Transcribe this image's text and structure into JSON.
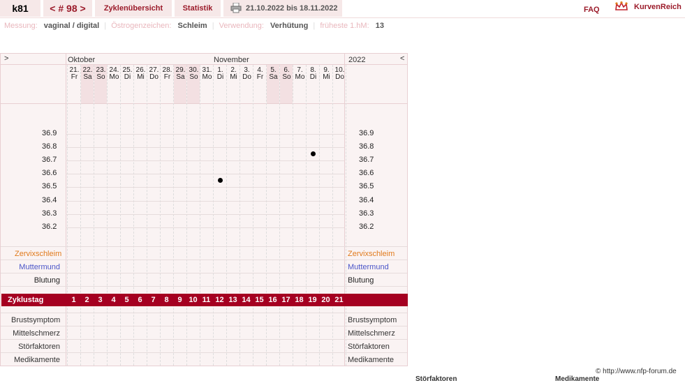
{
  "topbar": {
    "user": "k81",
    "cycle_nav": "< # 98 >",
    "tab_overview": "Zyklenübersicht",
    "tab_stats": "Statistik",
    "date_range": "21.10.2022 bis 18.11.2022",
    "faq": "FAQ",
    "brand": "KurvenReich"
  },
  "info": {
    "measurement_label": "Messung:",
    "measurement_value": "vaginal / digital",
    "estrogen_label": "Östrogenzeichen:",
    "estrogen_value": "Schleim",
    "usage_label": "Verwendung:",
    "usage_value": "Verhütung",
    "earliest_label": "früheste 1.hM:",
    "earliest_value": "13"
  },
  "chart": {
    "nav_prev": ">",
    "nav_next": "<",
    "month1": "Oktober",
    "month2": "November",
    "year": "2022",
    "days": [
      {
        "d": "21.",
        "w": "Fr",
        "we": false
      },
      {
        "d": "22.",
        "w": "Sa",
        "we": true
      },
      {
        "d": "23.",
        "w": "So",
        "we": true
      },
      {
        "d": "24.",
        "w": "Mo",
        "we": false
      },
      {
        "d": "25.",
        "w": "Di",
        "we": false
      },
      {
        "d": "26.",
        "w": "Mi",
        "we": false
      },
      {
        "d": "27.",
        "w": "Do",
        "we": false
      },
      {
        "d": "28.",
        "w": "Fr",
        "we": false
      },
      {
        "d": "29.",
        "w": "Sa",
        "we": true
      },
      {
        "d": "30.",
        "w": "So",
        "we": true
      },
      {
        "d": "31.",
        "w": "Mo",
        "we": false
      },
      {
        "d": "1.",
        "w": "Di",
        "we": false
      },
      {
        "d": "2.",
        "w": "Mi",
        "we": false
      },
      {
        "d": "3.",
        "w": "Do",
        "we": false
      },
      {
        "d": "4.",
        "w": "Fr",
        "we": false
      },
      {
        "d": "5.",
        "w": "Sa",
        "we": true
      },
      {
        "d": "6.",
        "w": "So",
        "we": true
      },
      {
        "d": "7.",
        "w": "Mo",
        "we": false
      },
      {
        "d": "8.",
        "w": "Di",
        "we": false
      },
      {
        "d": "9.",
        "w": "Mi",
        "we": false
      },
      {
        "d": "10.",
        "w": "Do",
        "we": false
      }
    ],
    "temps": [
      "36.9",
      "36.8",
      "36.7",
      "36.6",
      "36.5",
      "36.4",
      "36.3",
      "36.2"
    ],
    "points": [
      {
        "day_index": 11,
        "temp": 36.55
      },
      {
        "day_index": 18,
        "temp": 36.75
      }
    ],
    "row_labels": {
      "cervical_mucus": "Zervixschleim",
      "cervix": "Muttermund",
      "bleeding": "Blutung",
      "cycle_day": "Zyklustag",
      "breast": "Brustsymptom",
      "mittelschmerz": "Mittelschmerz",
      "disturbances": "Störfaktoren",
      "medication": "Medikamente"
    },
    "cycle_days": [
      "1",
      "2",
      "3",
      "4",
      "5",
      "6",
      "7",
      "8",
      "9",
      "10",
      "11",
      "12",
      "13",
      "14",
      "15",
      "16",
      "17",
      "18",
      "19",
      "20",
      "21"
    ],
    "colors": {
      "accent": "#a50021",
      "mucus": "#e07a1c",
      "cervix": "#4a55c8"
    }
  },
  "footer": {
    "credit": "© http://www.nfp-forum.de",
    "legend1": "Störfaktoren",
    "legend2": "Medikamente"
  }
}
